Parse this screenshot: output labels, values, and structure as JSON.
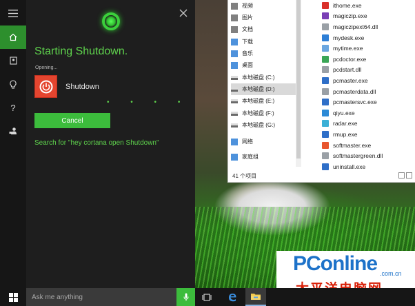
{
  "cortana": {
    "title": "Starting Shutdown.",
    "opening_label": "Opening...",
    "app_name": "Shutdown",
    "progress_dots": "• • • •",
    "cancel_label": "Cancel",
    "search_hint": "Search for \"hey cortana open Shutdown\"",
    "rail_items": [
      "menu-icon",
      "home-icon",
      "notebook-icon",
      "lightbulb-icon",
      "help-icon",
      "feedback-icon"
    ],
    "accent_color": "#3cbc3c"
  },
  "explorer": {
    "nav_items": [
      {
        "label": "视频",
        "icon": "video-folder-icon"
      },
      {
        "label": "图片",
        "icon": "pictures-folder-icon"
      },
      {
        "label": "文档",
        "icon": "documents-folder-icon"
      },
      {
        "label": "下载",
        "icon": "downloads-folder-icon"
      },
      {
        "label": "音乐",
        "icon": "music-folder-icon"
      },
      {
        "label": "桌面",
        "icon": "desktop-folder-icon"
      },
      {
        "label": "本地磁盘 (C:)",
        "icon": "drive-icon"
      },
      {
        "label": "本地磁盘 (D:)",
        "icon": "drive-icon",
        "selected": true
      },
      {
        "label": "本地磁盘 (E:)",
        "icon": "drive-icon"
      },
      {
        "label": "本地磁盘 (F:)",
        "icon": "drive-icon"
      },
      {
        "label": "本地磁盘 (G:)",
        "icon": "drive-icon"
      },
      {
        "label": "网络",
        "icon": "network-icon"
      },
      {
        "label": "家庭组",
        "icon": "homegroup-icon"
      }
    ],
    "files": [
      {
        "name": "ithome.exe",
        "color": "#d9302a"
      },
      {
        "name": "magiczip.exe",
        "color": "#7a3fb5"
      },
      {
        "name": "magiczipext64.dll",
        "color": "#9aa0a6"
      },
      {
        "name": "mydesk.exe",
        "color": "#2e7fd6"
      },
      {
        "name": "mytime.exe",
        "color": "#6aa6e0"
      },
      {
        "name": "pcdoctor.exe",
        "color": "#3aa657"
      },
      {
        "name": "pcdstart.dll",
        "color": "#9aa0a6"
      },
      {
        "name": "pcmaster.exe",
        "color": "#2f6fc8"
      },
      {
        "name": "pcmasterdata.dll",
        "color": "#9aa0a6"
      },
      {
        "name": "pcmastersvc.exe",
        "color": "#2f6fc8"
      },
      {
        "name": "qiyu.exe",
        "color": "#2c8ad6"
      },
      {
        "name": "radar.exe",
        "color": "#3bb0d6"
      },
      {
        "name": "rmup.exe",
        "color": "#2f6fc8"
      },
      {
        "name": "softmaster.exe",
        "color": "#e8562f"
      },
      {
        "name": "softmastergreen.dll",
        "color": "#9aa0a6"
      },
      {
        "name": "uninstall.exe",
        "color": "#2f6fc8"
      }
    ],
    "status": "41 个项目"
  },
  "taskbar": {
    "search_placeholder": "Ask me anything"
  },
  "watermark": {
    "logo_text": "PConline",
    "domain_suffix": ".com.cn",
    "chinese_name": "太平洋电脑网"
  }
}
